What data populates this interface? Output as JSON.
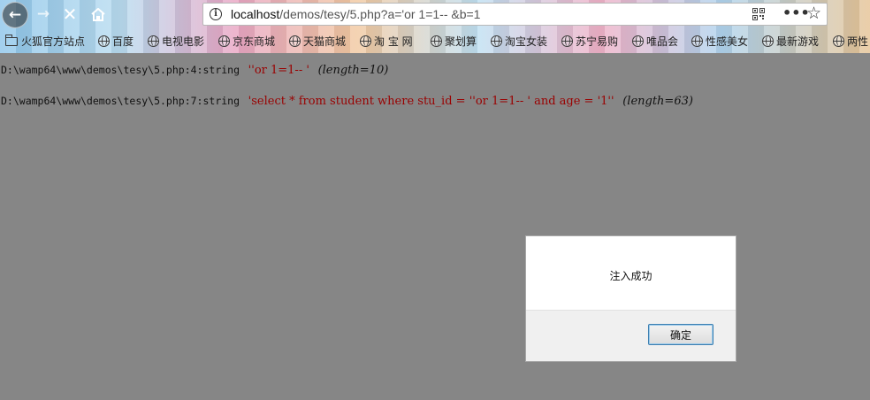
{
  "browser": {
    "url_host": "localhost",
    "url_rest": "/demos/tesy/5.php?a='or 1=1-- &b=1",
    "icons": {
      "back": "back-arrow-icon",
      "forward": "forward-arrow-icon",
      "stop": "close-icon",
      "home": "home-icon",
      "info": "info-icon",
      "qr": "qr-code-icon",
      "more": "more-icon",
      "bookmark": "star-icon"
    }
  },
  "bookmarks": [
    {
      "label": "火狐官方站点",
      "icon": "folder-icon"
    },
    {
      "label": "百度",
      "icon": "globe-icon"
    },
    {
      "label": "电视电影",
      "icon": "globe-icon"
    },
    {
      "label": "京东商城",
      "icon": "globe-icon"
    },
    {
      "label": "天猫商城",
      "icon": "globe-icon"
    },
    {
      "label": "淘 宝 网",
      "icon": "globe-icon"
    },
    {
      "label": "聚划算",
      "icon": "globe-icon"
    },
    {
      "label": "淘宝女装",
      "icon": "globe-icon"
    },
    {
      "label": "苏宁易购",
      "icon": "globe-icon"
    },
    {
      "label": "唯品会",
      "icon": "globe-icon"
    },
    {
      "label": "性感美女",
      "icon": "globe-icon"
    },
    {
      "label": "最新游戏",
      "icon": "globe-icon"
    },
    {
      "label": "两性",
      "icon": "globe-icon"
    }
  ],
  "output": [
    {
      "file": "D:\\wamp64\\www\\demos\\tesy\\5.php:4:string",
      "value": "''or 1=1-- '",
      "length": "(length=10)"
    },
    {
      "file": "D:\\wamp64\\www\\demos\\tesy\\5.php:7:string",
      "value": "'select * from student where stu_id = ''or 1=1-- ' and age = '1''",
      "length": "(length=63)"
    }
  ],
  "dialog": {
    "message": "注入成功",
    "ok_label": "确定"
  }
}
